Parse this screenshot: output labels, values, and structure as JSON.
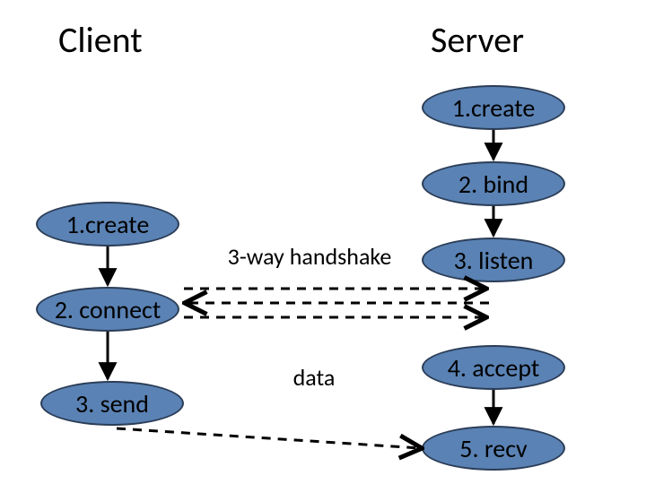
{
  "headings": {
    "client": "Client",
    "server": "Server"
  },
  "client_nodes": {
    "step1": "1.create",
    "step2": "2. connect",
    "step3": "3. send"
  },
  "server_nodes": {
    "step1": "1.create",
    "step2": "2. bind",
    "step3": "3. listen",
    "step4": "4. accept",
    "step5": "5. recv"
  },
  "labels": {
    "handshake": "3-way handshake",
    "data": "data"
  }
}
